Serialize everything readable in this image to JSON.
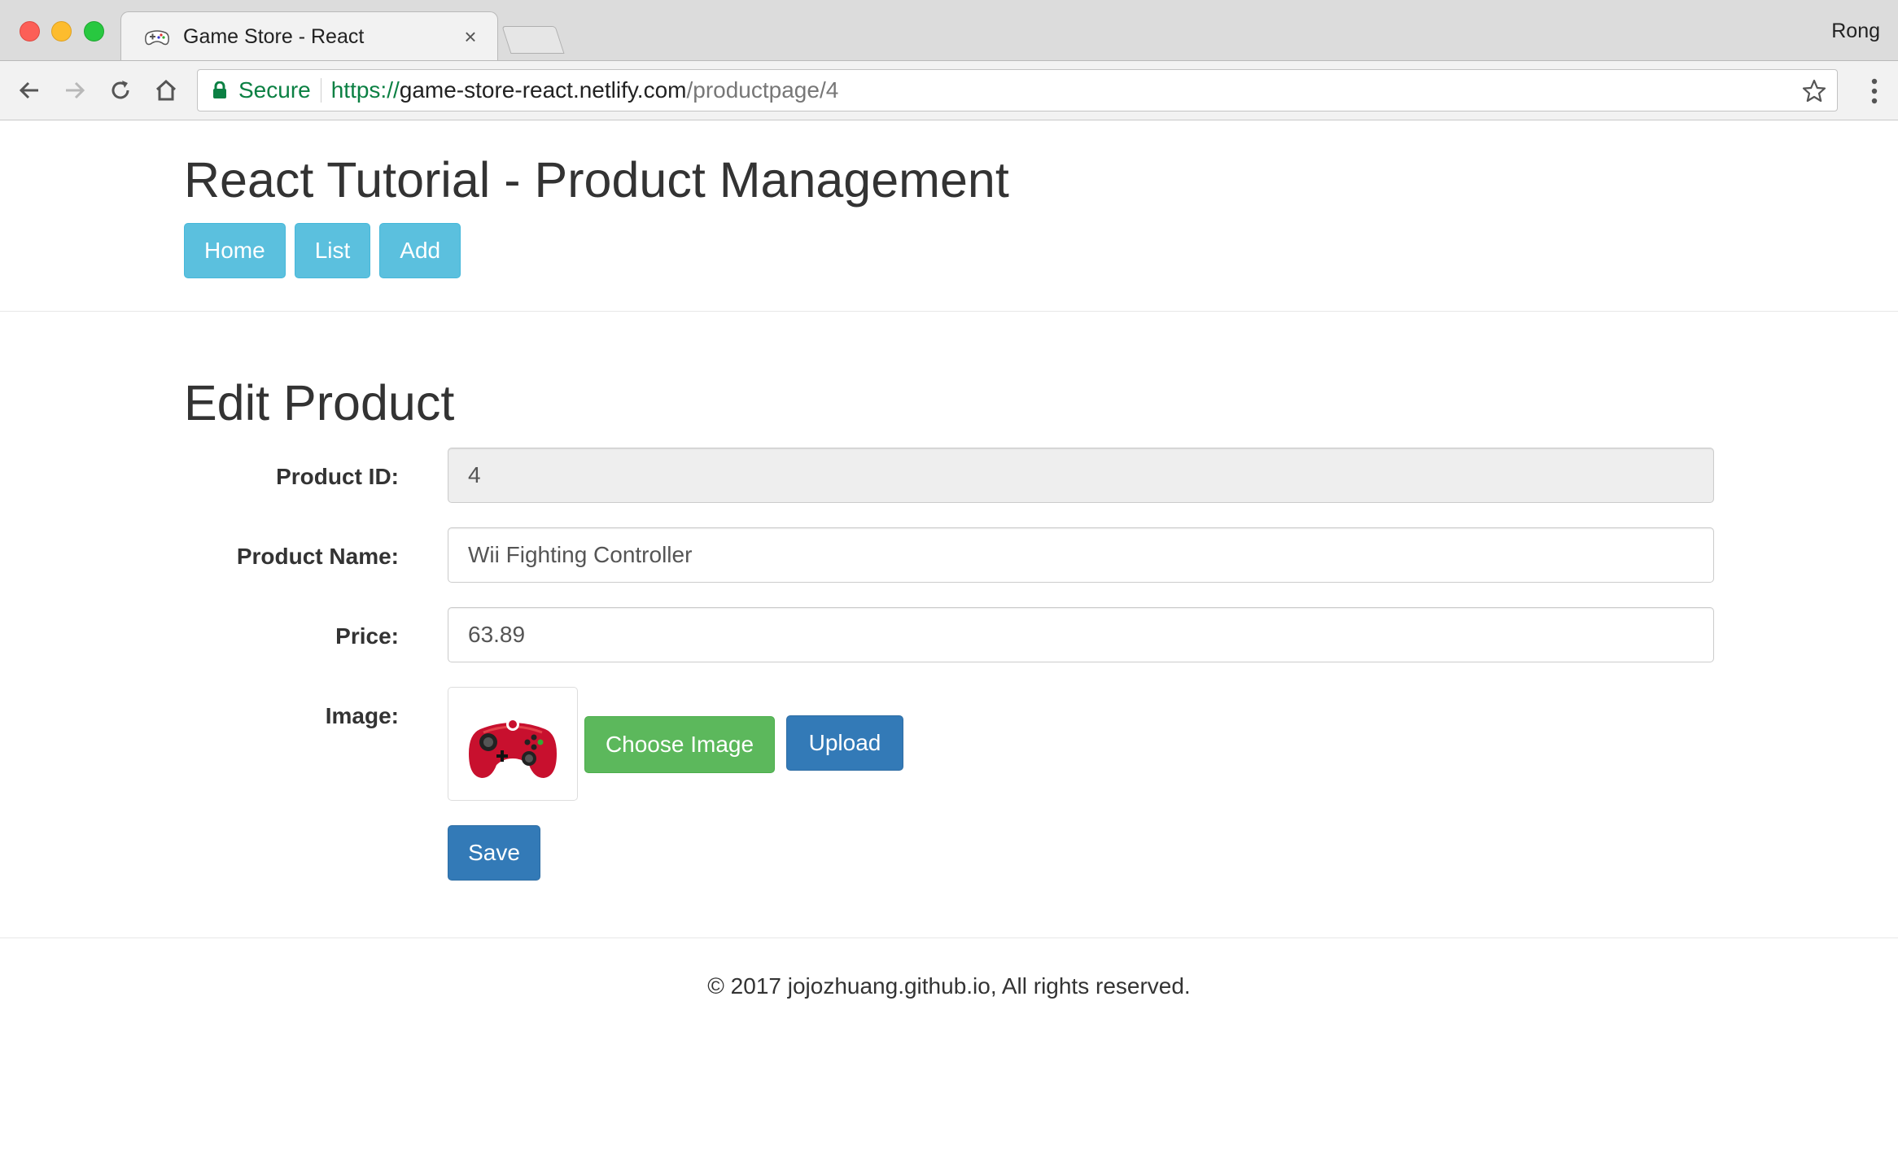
{
  "browser": {
    "tab_title": "Game Store - React",
    "tab_close": "×",
    "profile_name": "Rong",
    "secure_label": "Secure",
    "url_scheme": "https://",
    "url_host": "game-store-react.netlify.com",
    "url_path": "/productpage/4"
  },
  "header": {
    "title": "React Tutorial - Product Management",
    "nav": {
      "home": "Home",
      "list": "List",
      "add": "Add"
    }
  },
  "form": {
    "heading": "Edit Product",
    "product_id_label": "Product ID:",
    "product_id_value": "4",
    "product_name_label": "Product Name:",
    "product_name_value": "Wii Fighting Controller",
    "price_label": "Price:",
    "price_value": "63.89",
    "image_label": "Image:",
    "choose_image_label": "Choose Image",
    "upload_label": "Upload",
    "save_label": "Save"
  },
  "footer": {
    "text": "© 2017 jojozhuang.github.io, All rights reserved."
  },
  "colors": {
    "info": "#5bc0de",
    "success": "#5cb85c",
    "primary": "#337ab7",
    "secure_green": "#0b8043",
    "controller_red": "#c8102e"
  },
  "icons": [
    "back-icon",
    "forward-icon",
    "reload-icon",
    "home-icon",
    "lock-icon",
    "star-icon",
    "menu-icon",
    "close-icon",
    "gamepad-favicon-icon",
    "controller-image"
  ]
}
